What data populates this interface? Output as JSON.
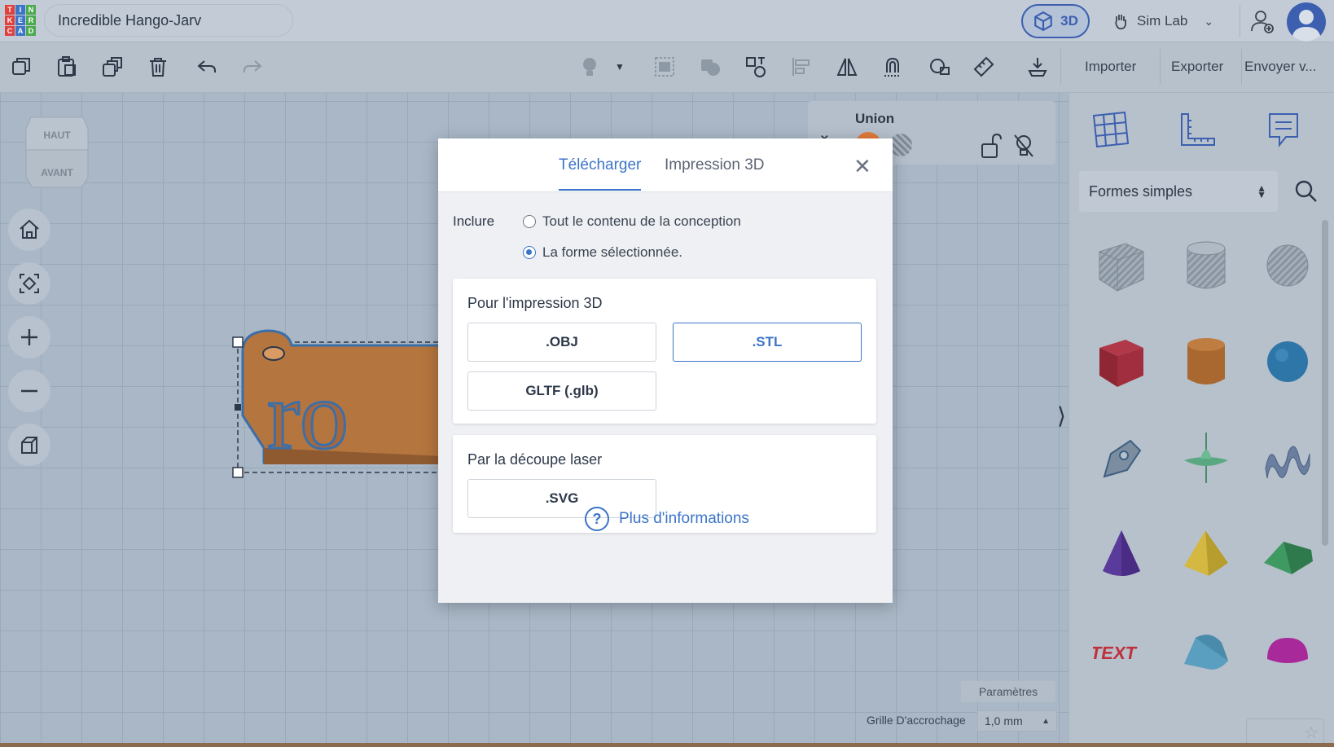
{
  "app": {
    "logo_letters": [
      "T",
      "I",
      "N",
      "K",
      "E",
      "R",
      "C",
      "A",
      "D"
    ],
    "logo_colors": [
      "#e0413b",
      "#3c75c8",
      "#4caa4e",
      "#e0413b",
      "#3c75c8",
      "#4caa4e",
      "#e0413b",
      "#3c75c8",
      "#4caa4e"
    ],
    "design_title": "Incredible Hango-Jarv",
    "view_3d_label": "3D",
    "simlab_label": "Sim Lab"
  },
  "toolbar": {
    "import_label": "Importer",
    "export_label": "Exporter",
    "send_label": "Envoyer v..."
  },
  "viewcube": {
    "top_label": "HAUT",
    "front_label": "AVANT"
  },
  "union_panel": {
    "title": "Union"
  },
  "right_panel": {
    "category_select": "Formes simples"
  },
  "workspace": {
    "shape_text": "ro"
  },
  "bottom": {
    "params_label": "Paramètres",
    "grid_label": "Grille D'accrochage",
    "grid_value": "1,0 mm"
  },
  "modal": {
    "tab_download": "Télécharger",
    "tab_print": "Impression 3D",
    "include_label": "Inclure",
    "option_all": "Tout le contenu de la conception",
    "option_selected": "La forme sélectionnée.",
    "selected_option": "La forme sélectionnée.",
    "print_section_title": "Pour l'impression 3D",
    "print_formats": [
      ".OBJ",
      ".STL",
      "GLTF (.glb)"
    ],
    "selected_format": ".STL",
    "laser_section_title": "Par la découpe laser",
    "laser_formats": [
      ".SVG"
    ],
    "more_info": "Plus d'informations"
  },
  "colors": {
    "accent": "#3c75c8",
    "brand_3d": "#3c5fb0",
    "shape_orange": "#b5753f",
    "background": "#a9b7c6"
  }
}
